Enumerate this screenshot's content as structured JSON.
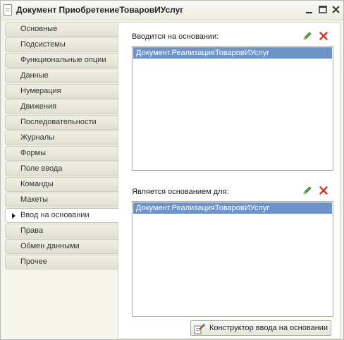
{
  "window": {
    "title": "Документ ПриобретениеТоваровИУслуг",
    "controls": [
      "minimize-icon",
      "maximize-icon",
      "close-icon"
    ]
  },
  "tabs": [
    {
      "label": "Основные"
    },
    {
      "label": "Подсистемы"
    },
    {
      "label": "Функциональные опции"
    },
    {
      "label": "Данные"
    },
    {
      "label": "Нумерация"
    },
    {
      "label": "Движения"
    },
    {
      "label": "Последовательности"
    },
    {
      "label": "Журналы"
    },
    {
      "label": "Формы"
    },
    {
      "label": "Поле ввода"
    },
    {
      "label": "Команды"
    },
    {
      "label": "Макеты"
    },
    {
      "label": "Ввод на основании",
      "active": true
    },
    {
      "label": "Права"
    },
    {
      "label": "Обмен данными"
    },
    {
      "label": "Прочее"
    }
  ],
  "based_on": {
    "label": "Вводится на основании:",
    "items": [
      "Документ.РеализацияТоваровИУслуг"
    ],
    "icons": [
      "edit-icon",
      "delete-icon"
    ]
  },
  "basis_for": {
    "label": "Является основанием для:",
    "items": [
      "Документ.РеализацияТоваровИУслуг"
    ],
    "icons": [
      "edit-icon",
      "delete-icon"
    ]
  },
  "constructor_button": {
    "label": "Конструктор ввода на основании"
  },
  "colors": {
    "selection": "#6d93c9",
    "window_bg": "#f5f5ec",
    "delete_red": "#d63a2a",
    "edit_green": "#3a9a2a"
  }
}
